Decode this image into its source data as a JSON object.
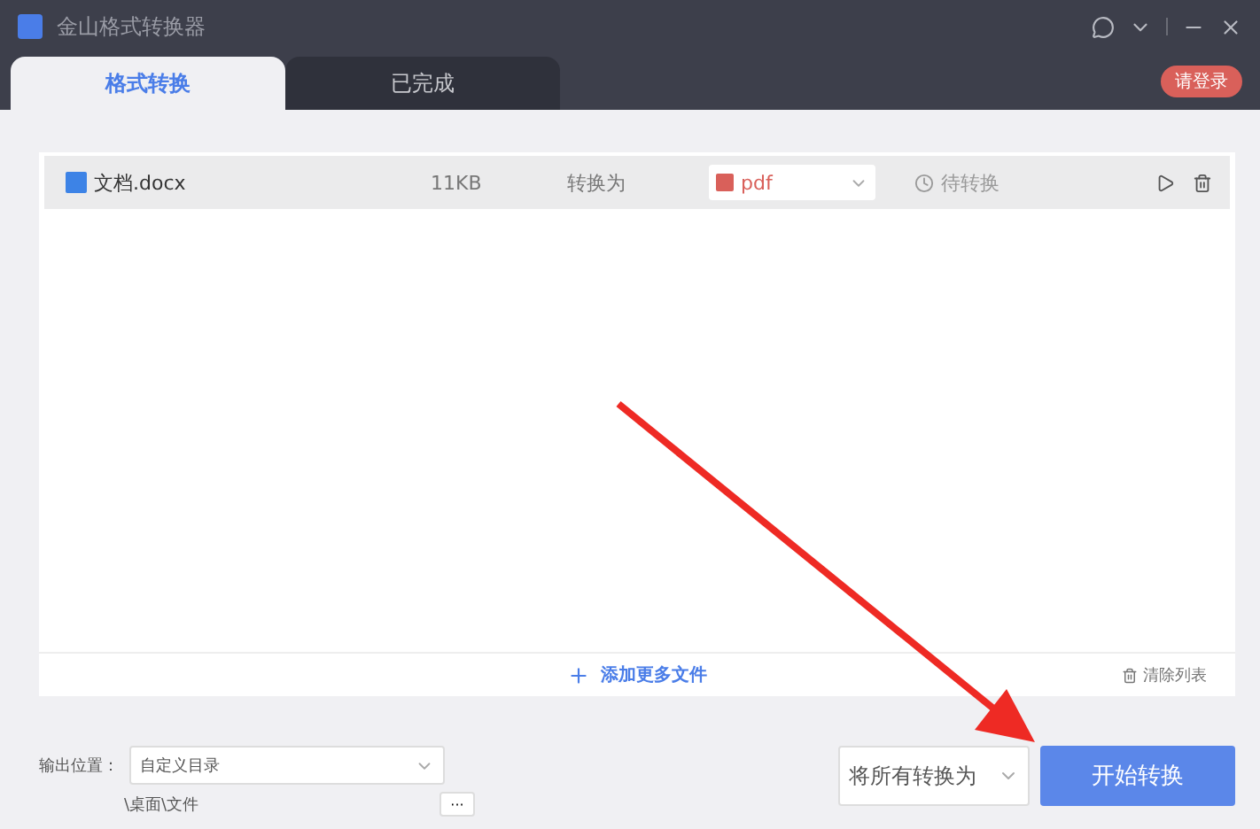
{
  "window": {
    "title": "金山格式转换器"
  },
  "tabs": [
    {
      "label": "格式转换",
      "selected": true
    },
    {
      "label": "已完成",
      "selected": false
    }
  ],
  "login_button": "请登录",
  "files": [
    {
      "name": "文档.docx",
      "size": "11KB",
      "convert_label": "转换为",
      "format": "pdf",
      "status": "待转换"
    }
  ],
  "add_more": "添加更多文件",
  "clear_list": "清除列表",
  "output": {
    "label": "输出位置：",
    "select": "自定义目录",
    "path": "\\桌面\\文件",
    "browse": "···"
  },
  "convert_all": "将所有转换为",
  "start_button": "开始转换"
}
